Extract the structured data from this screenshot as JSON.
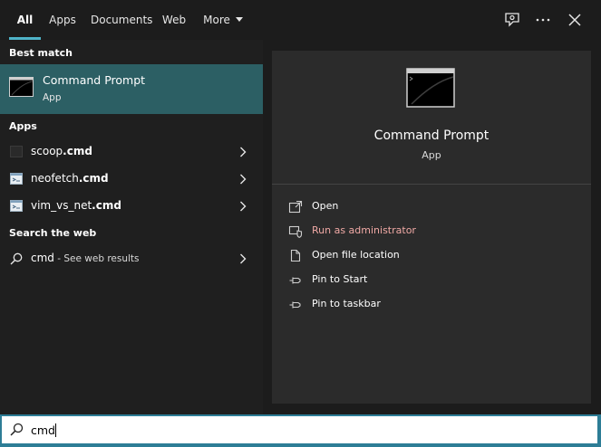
{
  "tabs": [
    {
      "label": "All",
      "active": true
    },
    {
      "label": "Apps"
    },
    {
      "label": "Documents"
    },
    {
      "label": "Web"
    },
    {
      "label": "More"
    }
  ],
  "top_icons": [
    "feedback-icon",
    "more-options-icon",
    "close-icon"
  ],
  "sections": {
    "best_match": "Best match",
    "apps": "Apps",
    "web": "Search the web"
  },
  "best_match": {
    "title": "Command Prompt",
    "subtitle": "App"
  },
  "apps": [
    {
      "name": "scoop",
      "ext": ".cmd",
      "icon": "blank-file-icon"
    },
    {
      "name": "neofetch",
      "ext": ".cmd",
      "icon": "batch-file-icon"
    },
    {
      "name": "vim_vs_net",
      "ext": ".cmd",
      "icon": "batch-file-icon"
    }
  ],
  "web": {
    "query": "cmd",
    "hint": " - See web results"
  },
  "detail": {
    "title": "Command Prompt",
    "subtitle": "App",
    "actions": [
      {
        "label": "Open",
        "icon": "open-icon"
      },
      {
        "label": "Run as administrator",
        "icon": "shield-icon"
      },
      {
        "label": "Open file location",
        "icon": "file-location-icon"
      },
      {
        "label": "Pin to Start",
        "icon": "pin-icon"
      },
      {
        "label": "Pin to taskbar",
        "icon": "pin-icon"
      }
    ]
  },
  "search": {
    "value": "cmd"
  },
  "colors": {
    "accent": "#4fb3c8",
    "selected": "#2c5f64",
    "admin_text": "#f0a9a5",
    "search_border": "#2d7d96"
  }
}
